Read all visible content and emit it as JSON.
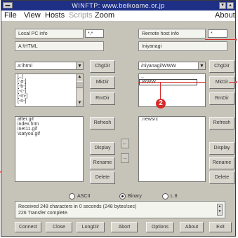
{
  "window": {
    "title": "WINFTP: www.beikoame.or.jp",
    "system_menu_glyph": "▬",
    "minimize_glyph": "▾",
    "maximize_glyph": "▴"
  },
  "menu": {
    "file": "File",
    "view": "View",
    "hosts": "Hosts",
    "scripts": "Scripts",
    "zoom": "Zoom",
    "about": "About"
  },
  "local": {
    "header_label": "Local PC info",
    "header_value": "*.*",
    "path": "A:\\HTML",
    "dir_combo": "a:\\html",
    "dir_list": [
      "[..]",
      "[-a-]",
      "[-b-]",
      "[-c-]",
      "[-m-]",
      "[-n-]"
    ],
    "file_list": [
      "after.gif",
      "index.htm",
      "inet11.gif",
      "\\satyou.gif"
    ],
    "buttons": {
      "chgdir": "ChgDir",
      "mkdir": "MkDir",
      "rmdir": "RmDir",
      "refresh": "Refresh",
      "display": "Display",
      "rename": "Rename",
      "delete": "Delete"
    }
  },
  "remote": {
    "header_label": "Remote host info",
    "header_value": "*",
    "path": "/niyanagi",
    "dir_combo": "/niyanagi/WWW",
    "dir_list": [
      "..",
      "WWW"
    ],
    "file_list": [
      ".newsrc"
    ],
    "buttons": {
      "chgdir": "ChgDir",
      "mkdir": "MkDir",
      "rmdir": "RmDir",
      "refresh": "Refresh",
      "display": "Display",
      "rename": "Rename",
      "delete": "Delete"
    }
  },
  "transfer": {
    "left_arrow": "←",
    "right_arrow": "→"
  },
  "mode": {
    "ascii": "ASCII",
    "binary": "Binary",
    "l8": "L 8",
    "selected": "binary"
  },
  "status": {
    "line1": "Received 248 characters in 0 seconds (248 bytes/sec)",
    "line2": "226 Transfer complete."
  },
  "bottom_buttons": {
    "connect": "Connect",
    "close": "Close",
    "longdir": "LongDir",
    "abort": "Abort",
    "options": "Options",
    "about": "About",
    "exit": "Exit"
  },
  "callout": {
    "number": "2",
    "color": "#d62b2b"
  },
  "colors": {
    "title_bar": "#1e2f86",
    "window_face": "#c6c3b9"
  }
}
